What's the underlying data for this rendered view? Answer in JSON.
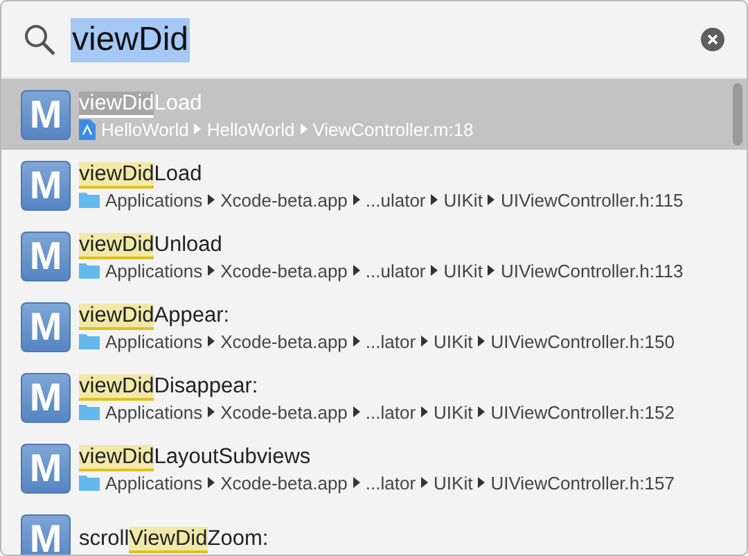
{
  "search": {
    "value": "viewDid",
    "selected_text": true
  },
  "results": [
    {
      "selected": true,
      "icon_letter": "M",
      "title": {
        "match": "viewDid",
        "after": "Load"
      },
      "path": {
        "kind": "project",
        "segments": [
          "HelloWorld",
          "HelloWorld",
          "ViewController.m:18"
        ]
      }
    },
    {
      "selected": false,
      "icon_letter": "M",
      "title": {
        "match": "viewDid",
        "after": "Load"
      },
      "path": {
        "kind": "folder",
        "segments": [
          "Applications",
          "Xcode-beta.app",
          "...ulator",
          "UIKit",
          "UIViewController.h:115"
        ]
      }
    },
    {
      "selected": false,
      "icon_letter": "M",
      "title": {
        "match": "viewDid",
        "after": "Unload"
      },
      "path": {
        "kind": "folder",
        "segments": [
          "Applications",
          "Xcode-beta.app",
          "...ulator",
          "UIKit",
          "UIViewController.h:113"
        ]
      }
    },
    {
      "selected": false,
      "icon_letter": "M",
      "title": {
        "match": "viewDid",
        "after": "Appear:"
      },
      "path": {
        "kind": "folder",
        "segments": [
          "Applications",
          "Xcode-beta.app",
          "...lator",
          "UIKit",
          "UIViewController.h:150"
        ]
      }
    },
    {
      "selected": false,
      "icon_letter": "M",
      "title": {
        "match": "viewDid",
        "after": "Disappear:"
      },
      "path": {
        "kind": "folder",
        "segments": [
          "Applications",
          "Xcode-beta.app",
          "...lator",
          "UIKit",
          "UIViewController.h:152"
        ]
      }
    },
    {
      "selected": false,
      "icon_letter": "M",
      "title": {
        "match": "viewDid",
        "after": "LayoutSubviews"
      },
      "path": {
        "kind": "folder",
        "segments": [
          "Applications",
          "Xcode-beta.app",
          "...lator",
          "UIKit",
          "UIViewController.h:157"
        ]
      }
    },
    {
      "selected": false,
      "icon_letter": "M",
      "title": {
        "before": "scroll",
        "match": "ViewDid",
        "after": "Zoom:"
      }
    }
  ]
}
